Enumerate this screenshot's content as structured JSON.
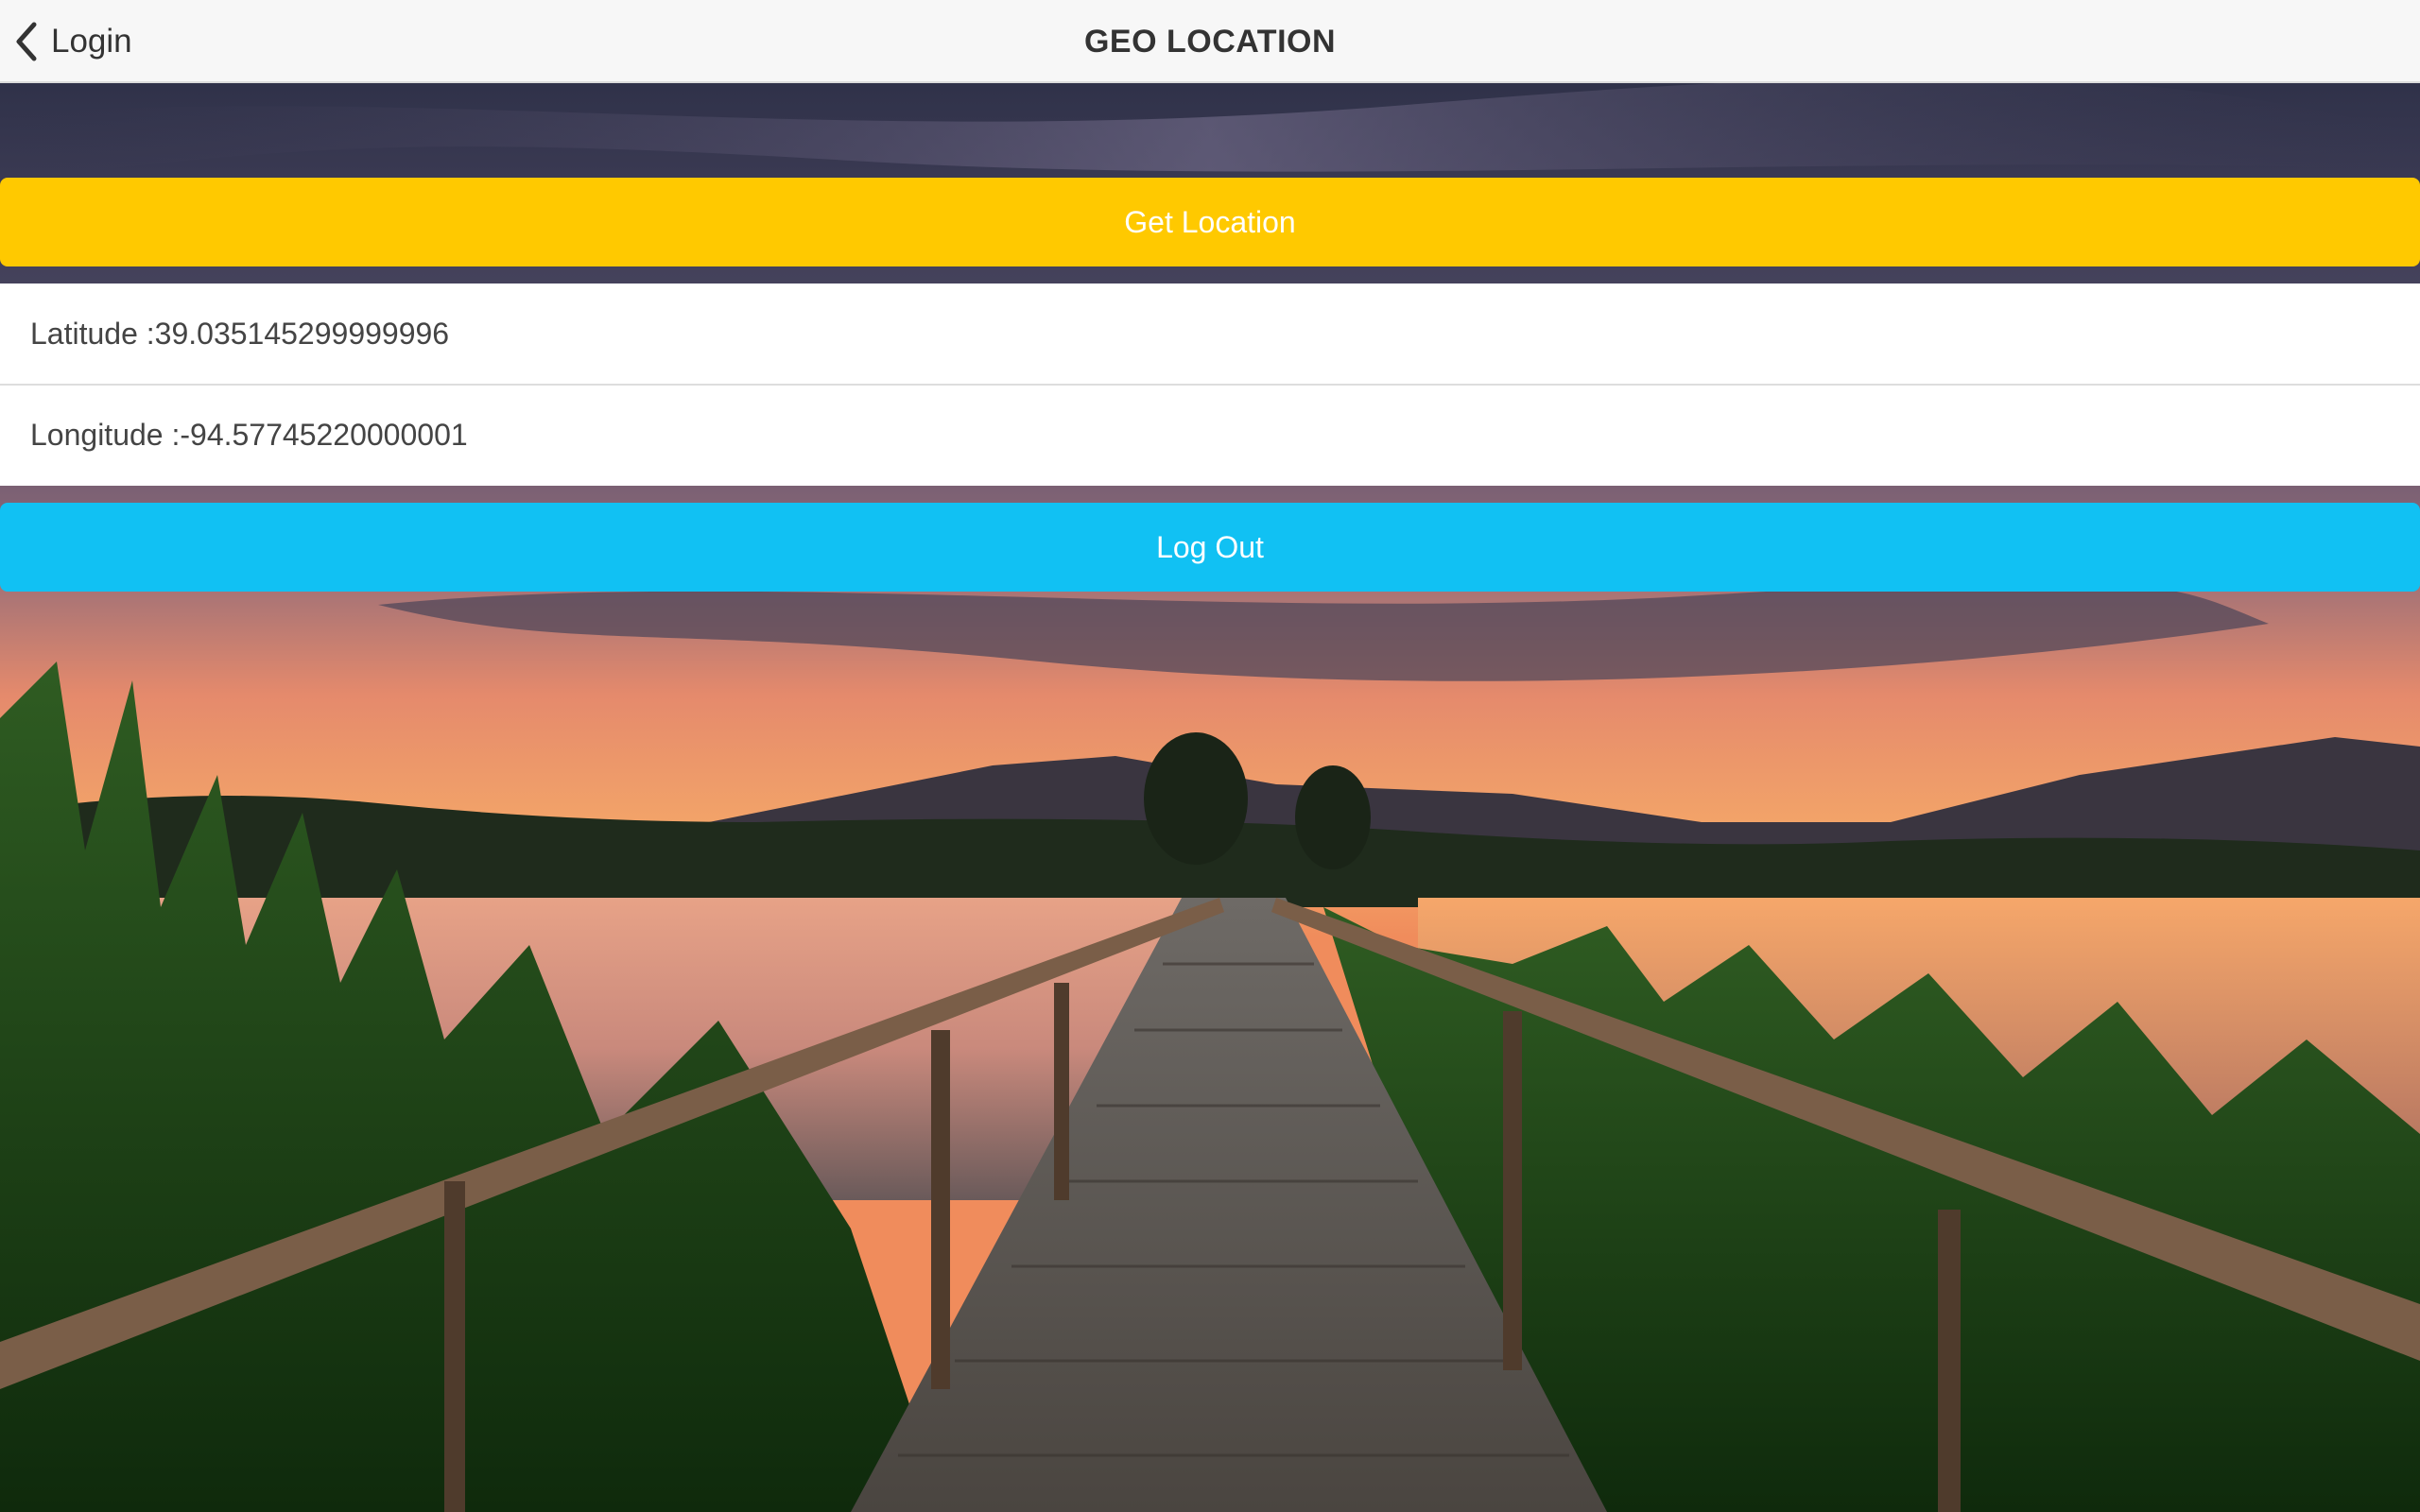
{
  "navbar": {
    "back_label": "Login",
    "title": "GEO LOCATION"
  },
  "actions": {
    "get_location_label": "Get Location",
    "logout_label": "Log Out"
  },
  "location": {
    "latitude_text": "Latitude :39.035145299999996",
    "longitude_text": "Longitude :-94.57745220000001"
  },
  "colors": {
    "get_location_button": "#ffc900",
    "logout_button": "#11c1f3",
    "navbar_bg": "#f7f7f7"
  },
  "icons": {
    "back": "chevron-left-icon"
  }
}
